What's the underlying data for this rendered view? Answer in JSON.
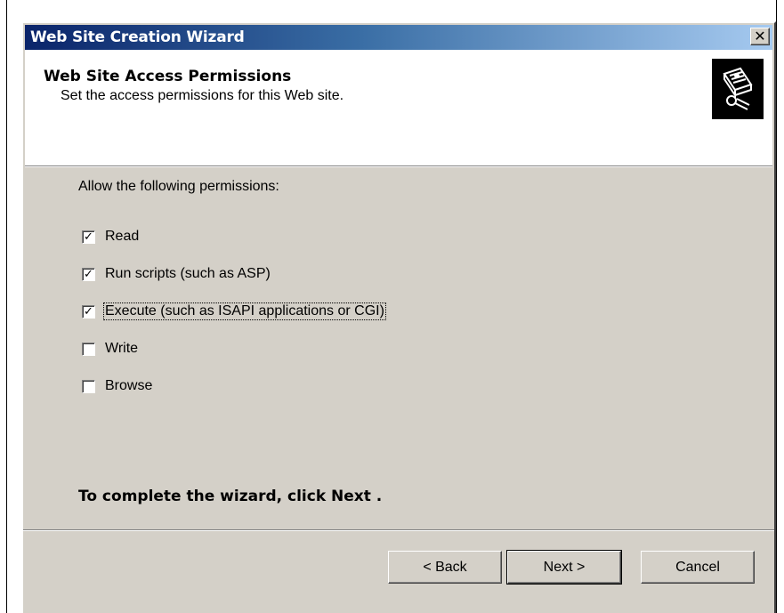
{
  "window": {
    "title": "Web Site Creation Wizard",
    "close_glyph": "✕"
  },
  "header": {
    "title": "Web Site Access Permissions",
    "subtitle": "Set the access permissions for this Web site.",
    "icon": "wizard-book-icon"
  },
  "content": {
    "allow_label": "Allow the following permissions:",
    "permissions": [
      {
        "label": "Read",
        "checked": true
      },
      {
        "label": "Run scripts (such as ASP)",
        "checked": true
      },
      {
        "label": "Execute (such as ISAPI applications or CGI)",
        "checked": true,
        "focused": true
      },
      {
        "label": "Write",
        "checked": false
      },
      {
        "label": "Browse",
        "checked": false
      }
    ],
    "complete_text": "To complete the wizard, click Next ."
  },
  "buttons": {
    "back": "< Back",
    "next": "Next >",
    "cancel": "Cancel"
  },
  "colors": {
    "titlebar_start": "#0a246a",
    "titlebar_end": "#a6caf0",
    "dialog_bg": "#d4d0c8"
  }
}
